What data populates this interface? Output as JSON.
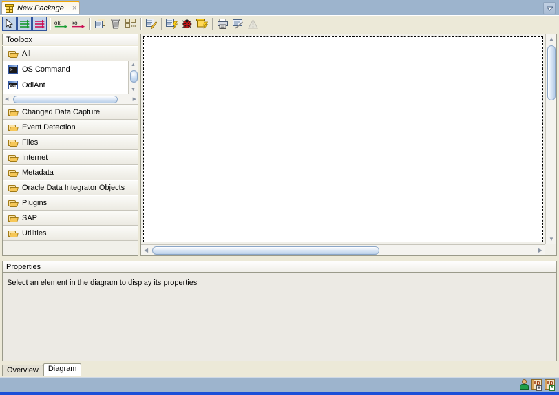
{
  "window": {
    "tab": {
      "title": "New Package",
      "icon": "package-icon",
      "close_label": "×"
    },
    "topright_button": "▼"
  },
  "toolbar": {
    "buttons": [
      {
        "name": "select-tool",
        "icon": "cursor-arrow-icon",
        "selected": true,
        "enabled": true
      },
      {
        "name": "ok-step-tool",
        "icon": "green-next-step-icon",
        "selected": true,
        "enabled": true
      },
      {
        "name": "ko-step-tool",
        "icon": "red-next-step-icon",
        "selected": true,
        "enabled": true
      },
      {
        "name": "ok-link-tool",
        "icon": "ok-arrow-icon",
        "label": "ok",
        "enabled": true
      },
      {
        "name": "ko-link-tool",
        "icon": "ko-arrow-icon",
        "label": "ko",
        "enabled": true
      },
      {
        "name": "duplicate-button",
        "icon": "copy-icon",
        "enabled": true
      },
      {
        "name": "delete-button",
        "icon": "trash-icon",
        "enabled": true
      },
      {
        "name": "arrange-button",
        "icon": "arrange-layout-icon",
        "enabled": true
      },
      {
        "name": "edit-button",
        "icon": "edit-pencil-icon",
        "enabled": true
      },
      {
        "name": "execute-button",
        "icon": "lightning-execute-icon",
        "enabled": true
      },
      {
        "name": "debug-button",
        "icon": "ladybug-debug-icon",
        "enabled": true
      },
      {
        "name": "generate-scenario-button",
        "icon": "package-lightning-icon",
        "enabled": true
      },
      {
        "name": "print-button",
        "icon": "printer-icon",
        "enabled": true
      },
      {
        "name": "print-preview-button",
        "icon": "print-preview-icon",
        "enabled": true
      },
      {
        "name": "warnings-button",
        "icon": "warning-triangle-icon",
        "enabled": false
      }
    ]
  },
  "toolbox": {
    "header": "Toolbox",
    "groups": [
      {
        "label": "All",
        "expanded": true,
        "items": [
          {
            "label": "OS Command",
            "icon": "os-command-icon"
          },
          {
            "label": "OdiAnt",
            "icon": "odi-ant-icon"
          }
        ]
      },
      {
        "label": "Changed Data Capture",
        "expanded": false,
        "items": []
      },
      {
        "label": "Event Detection",
        "expanded": false,
        "items": []
      },
      {
        "label": "Files",
        "expanded": false,
        "items": []
      },
      {
        "label": "Internet",
        "expanded": false,
        "items": []
      },
      {
        "label": "Metadata",
        "expanded": false,
        "items": []
      },
      {
        "label": "Oracle Data Integrator Objects",
        "expanded": false,
        "items": []
      },
      {
        "label": "Plugins",
        "expanded": false,
        "items": []
      },
      {
        "label": "SAP",
        "expanded": false,
        "items": []
      },
      {
        "label": "Utilities",
        "expanded": false,
        "items": []
      }
    ]
  },
  "canvas": {
    "name": "package-diagram-canvas",
    "empty": true
  },
  "properties": {
    "header": "Properties",
    "message": "Select an element in the diagram to display its properties"
  },
  "bottom_tabs": [
    {
      "label": "Overview",
      "active": false
    },
    {
      "label": "Diagram",
      "active": true
    }
  ],
  "statusbar": {
    "icons": [
      {
        "name": "user-icon"
      },
      {
        "name": "dictionary-ab-m-icon",
        "label": "AB",
        "badge": "M"
      },
      {
        "name": "dictionary-ab-flag-icon",
        "label": "AB",
        "badge": "⚑"
      }
    ]
  },
  "colors": {
    "titlebar_blue": "#9db4cd",
    "status_strip": "#1b4fd8",
    "tab_accent": "#f0a80a",
    "panel_bg": "#ece9d8",
    "selection_border": "#31549c"
  }
}
